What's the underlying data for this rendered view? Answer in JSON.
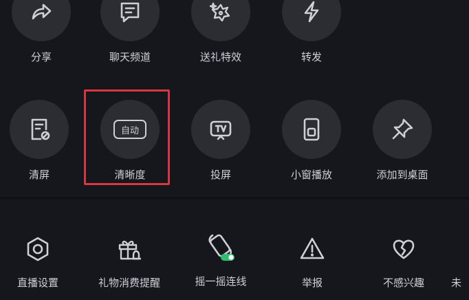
{
  "row1": [
    {
      "label": "分享",
      "icon": "share-icon"
    },
    {
      "label": "聊天频道",
      "icon": "chat-icon"
    },
    {
      "label": "送礼特效",
      "icon": "gift-effect-icon"
    },
    {
      "label": "转发",
      "icon": "lightning-icon"
    }
  ],
  "row2": [
    {
      "label": "清屏",
      "icon": "clear-screen-icon"
    },
    {
      "label": "清晰度",
      "icon": "auto-quality-icon",
      "badge": "自动"
    },
    {
      "label": "投屏",
      "icon": "tv-cast-icon"
    },
    {
      "label": "小窗播放",
      "icon": "mini-window-icon"
    },
    {
      "label": "添加到桌面",
      "icon": "pin-icon"
    }
  ],
  "row3": [
    {
      "label": "直播设置",
      "icon": "settings-hex-icon"
    },
    {
      "label": "礼物消费提醒",
      "icon": "gift-bell-icon"
    },
    {
      "label": "摇一摇连线",
      "icon": "shake-phone-icon"
    },
    {
      "label": "举报",
      "icon": "warning-icon"
    },
    {
      "label": "不感兴趣",
      "icon": "broken-heart-icon"
    },
    {
      "label": "未",
      "icon": ""
    }
  ],
  "colors": {
    "background": "#16171d",
    "circle": "#2c2d33",
    "text": "#cfd0d6",
    "highlight": "#d8373f",
    "toggle": "#2fbf71"
  }
}
